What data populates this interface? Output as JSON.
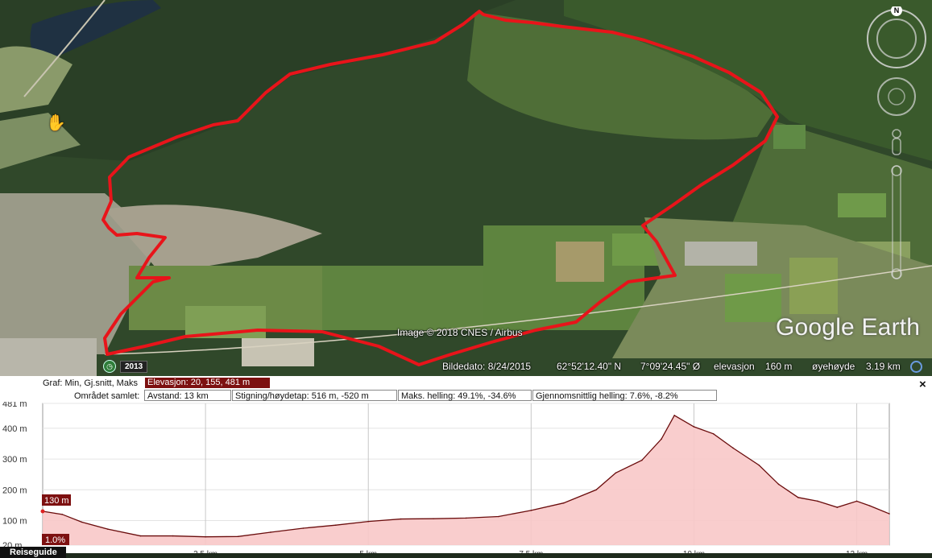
{
  "map": {
    "copyright": "Image © 2018 CNES / Airbus",
    "brand": "Google Earth",
    "imagery_year": "2013",
    "compass_north": "N",
    "route_color": "#e8141a"
  },
  "statusbar": {
    "image_date": "Bildedato: 8/24/2015",
    "latitude": "62°52'12.40\" N",
    "longitude": "7°09'24.45\" Ø",
    "elevation_label": "elevasjon",
    "elevation_value": "160 m",
    "eye_alt_label": "øyehøyde",
    "eye_alt_value": "3.19 km"
  },
  "profile": {
    "graph_label": "Graf: Min, Gj.snitt, Maks",
    "elevation_badge": "Elevasjon: 20, 155, 481 m",
    "summary_label": "Området samlet:",
    "distance": "Avstand: 13 km",
    "gain_loss": "Stigning/høydetap: 516 m, -520 m",
    "max_slope": "Maks. helling: 49.1%, -34.6%",
    "avg_slope": "Gjennomsnittlig helling: 7.6%, -8.2%",
    "close": "×",
    "guide_tab": "Reiseguide",
    "cursor_elevation": "130 m",
    "cursor_slope": "1.0%"
  },
  "chart_data": {
    "type": "area",
    "title": "",
    "xlabel": "",
    "ylabel": "",
    "y_ticks": [
      "481 m",
      "400 m",
      "300 m",
      "200 m",
      "100 m",
      "20 m"
    ],
    "y_tick_values": [
      481,
      400,
      300,
      200,
      100,
      20
    ],
    "x_ticks": [
      "2.5 km",
      "5 km",
      "7.5 km",
      "10 km",
      "12 km"
    ],
    "x_tick_values": [
      2.5,
      5,
      7.5,
      10,
      12.5
    ],
    "xlim": [
      0,
      13
    ],
    "ylim": [
      20,
      481
    ],
    "fill_color": "#f8c8c8",
    "line_color": "#6a0c0c",
    "series": [
      {
        "x": [
          0,
          0.3,
          0.6,
          1.0,
          1.5,
          2.0,
          2.5,
          3.0,
          3.5,
          4.0,
          4.5,
          5.0,
          5.5,
          6.0,
          6.5,
          7.0,
          7.5,
          8.0,
          8.5,
          8.8,
          9.2,
          9.5,
          9.7,
          10.0,
          10.3,
          10.6,
          11.0,
          11.3,
          11.6,
          11.9,
          12.2,
          12.5,
          12.7,
          13.0
        ],
        "values": [
          130,
          120,
          95,
          72,
          50,
          50,
          47,
          48,
          62,
          75,
          85,
          97,
          105,
          106,
          108,
          113,
          133,
          157,
          200,
          255,
          296,
          365,
          442,
          405,
          382,
          336,
          280,
          218,
          175,
          163,
          143,
          163,
          148,
          122
        ]
      }
    ]
  }
}
